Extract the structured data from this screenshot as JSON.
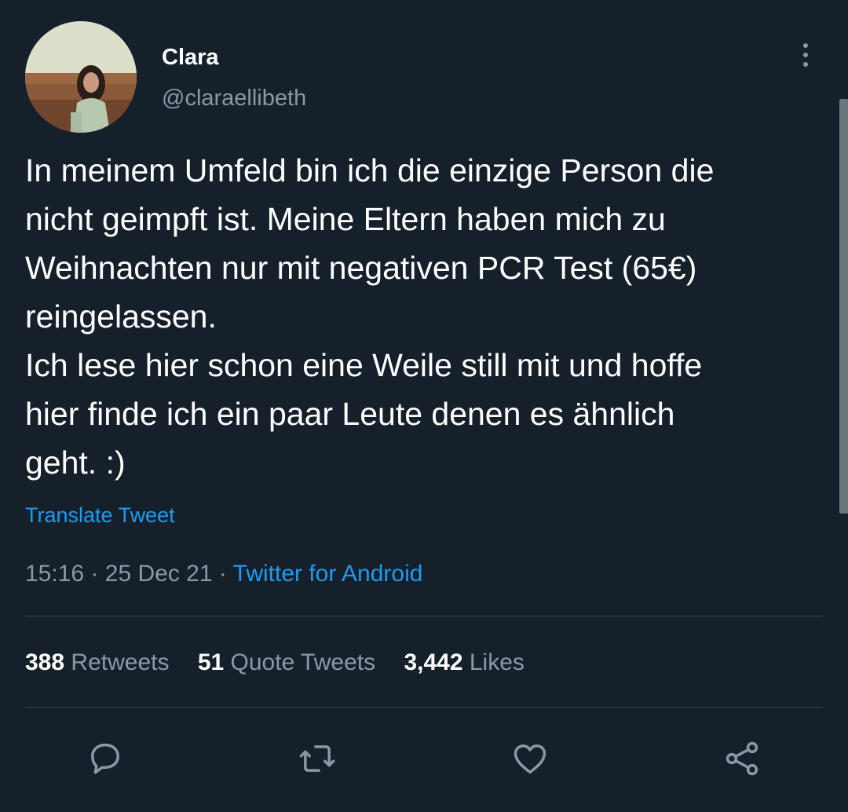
{
  "user": {
    "display_name": "Clara",
    "handle": "@claraellibeth"
  },
  "tweet": {
    "lines": [
      "In meinem Umfeld bin ich die einzige Person die",
      "nicht geimpft ist. Meine Eltern haben mich zu",
      "Weihnachten nur mit negativen PCR Test (65€)",
      "reingelassen.",
      "Ich lese hier schon eine Weile still mit und hoffe",
      "hier finde ich ein paar Leute denen es ähnlich",
      "geht. :)"
    ],
    "translate_label": "Translate Tweet",
    "time": "15:16",
    "date": "25 Dec 21",
    "separator": "·",
    "source": "Twitter for Android"
  },
  "stats": {
    "retweets_count": "388",
    "retweets_label": "Retweets",
    "quotes_count": "51",
    "quotes_label": "Quote Tweets",
    "likes_count": "3,442",
    "likes_label": "Likes"
  },
  "icons": {
    "reply": "reply-icon",
    "retweet": "retweet-icon",
    "like": "heart-icon",
    "share": "share-icon",
    "more": "more-vertical-icon"
  },
  "colors": {
    "background": "#15202b",
    "text_primary": "#ffffff",
    "text_secondary": "#8b98a5",
    "link": "#1d9bf0",
    "divider": "#38444d"
  }
}
